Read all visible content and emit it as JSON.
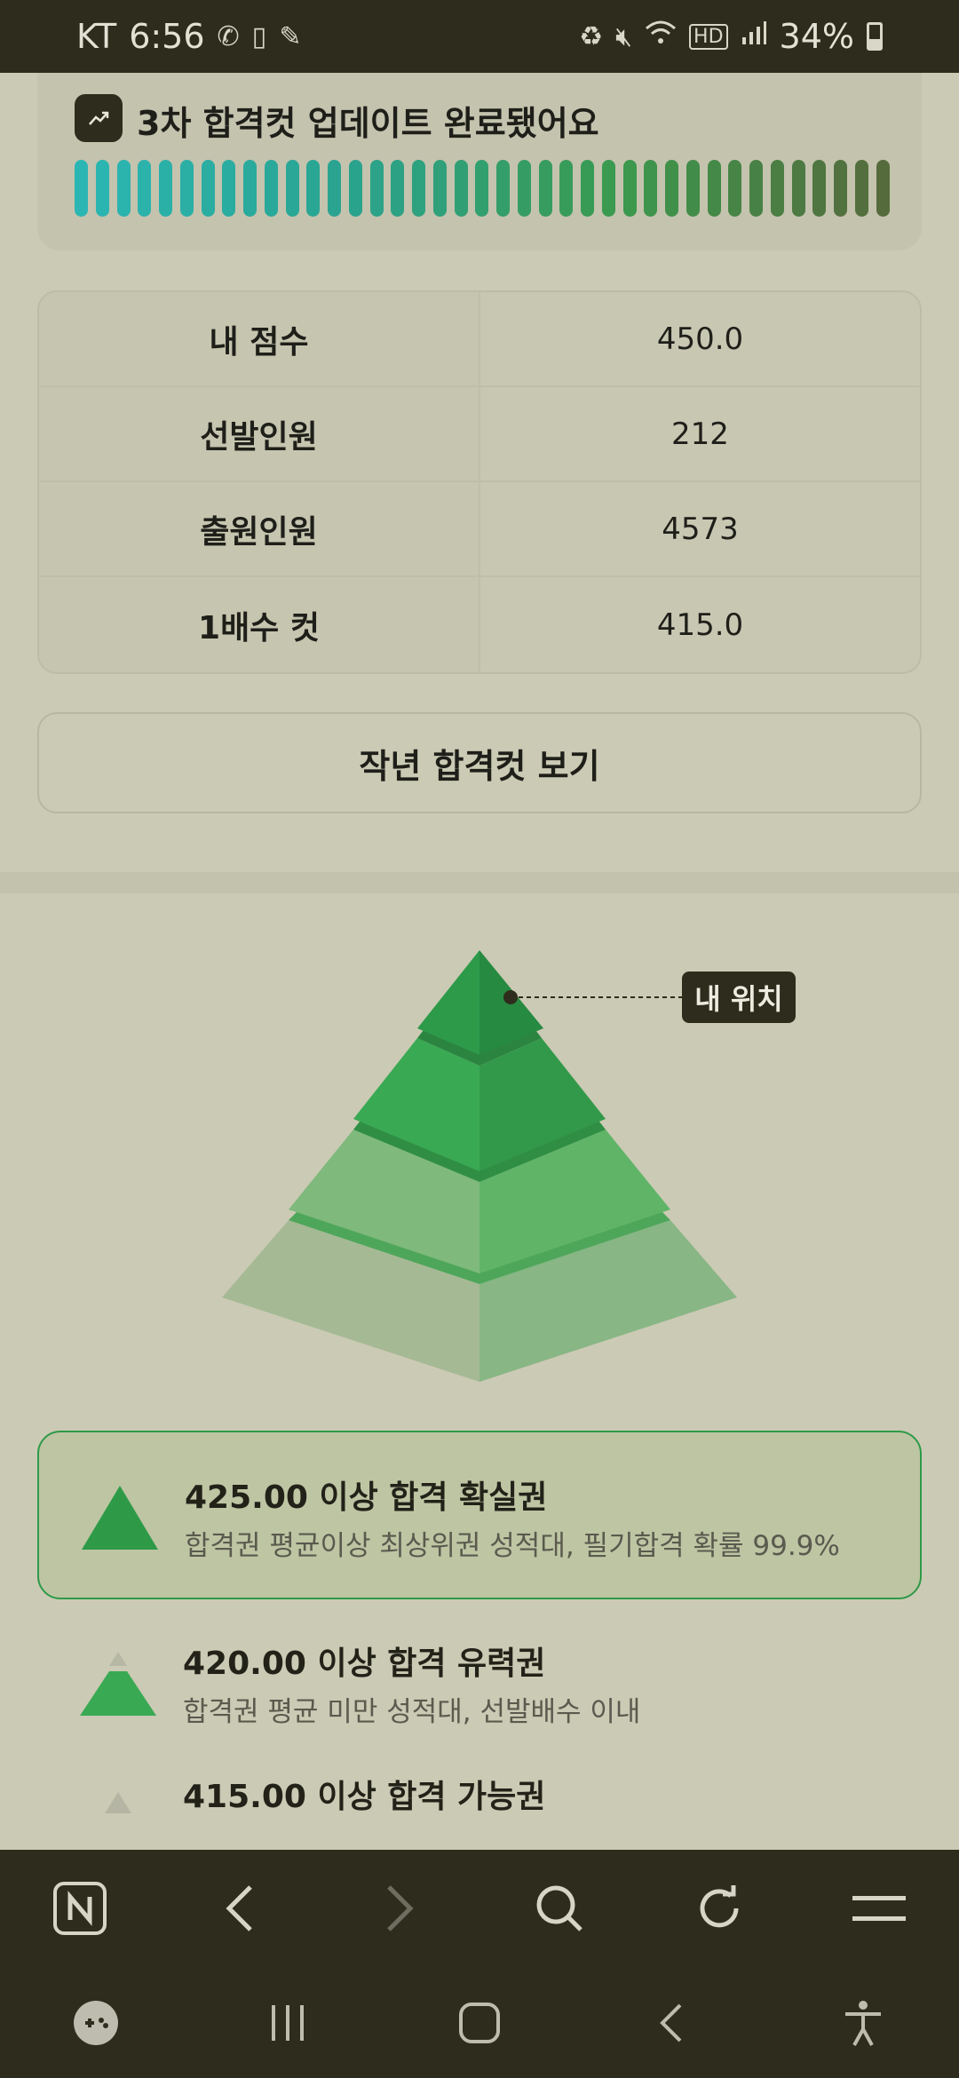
{
  "status_bar": {
    "carrier": "KT",
    "time": "6:56",
    "battery": "34%",
    "icons": [
      "call-icon",
      "phone-icon",
      "note-icon",
      "battery-saver-icon",
      "mute-icon",
      "wifi-icon",
      "hd-icon",
      "signal-icon",
      "battery-icon"
    ]
  },
  "update_banner": {
    "icon": "trend-up-icon",
    "title": "3차 합격컷 업데이트 완료됐어요",
    "progress": 1.0,
    "colors": [
      "#2bb6b4",
      "#2aa38f",
      "#3a9a4e",
      "#556b3c"
    ]
  },
  "score_table": {
    "rows": [
      {
        "label": "내 점수",
        "value": "450.0"
      },
      {
        "label": "선발인원",
        "value": "212"
      },
      {
        "label": "출원인원",
        "value": "4573"
      },
      {
        "label": "1배수 컷",
        "value": "415.0"
      }
    ]
  },
  "prev_year_button": "작년 합격컷 보기",
  "pyramid": {
    "my_position_label": "내 위치",
    "levels": 4,
    "my_level": 1
  },
  "tiers": [
    {
      "title": "425.00 이상 합격 확실권",
      "desc": "합격권 평균이상 최상위권 성적대, 필기합격 확률 99.9%",
      "active": true
    },
    {
      "title": "420.00 이상 합격 유력권",
      "desc": "합격권 평균 미만 성적대, 선발배수 이내",
      "active": false
    },
    {
      "title": "415.00 이상 합격 가능권",
      "desc": "",
      "active": false
    }
  ],
  "browser_bar": {
    "icons": [
      "naver-icon",
      "back-icon",
      "forward-icon",
      "search-icon",
      "refresh-icon",
      "menu-icon"
    ]
  },
  "nav_bar": {
    "icons": [
      "game-launcher-icon",
      "recent-apps-icon",
      "home-icon",
      "back-nav-icon",
      "accessibility-icon"
    ]
  }
}
